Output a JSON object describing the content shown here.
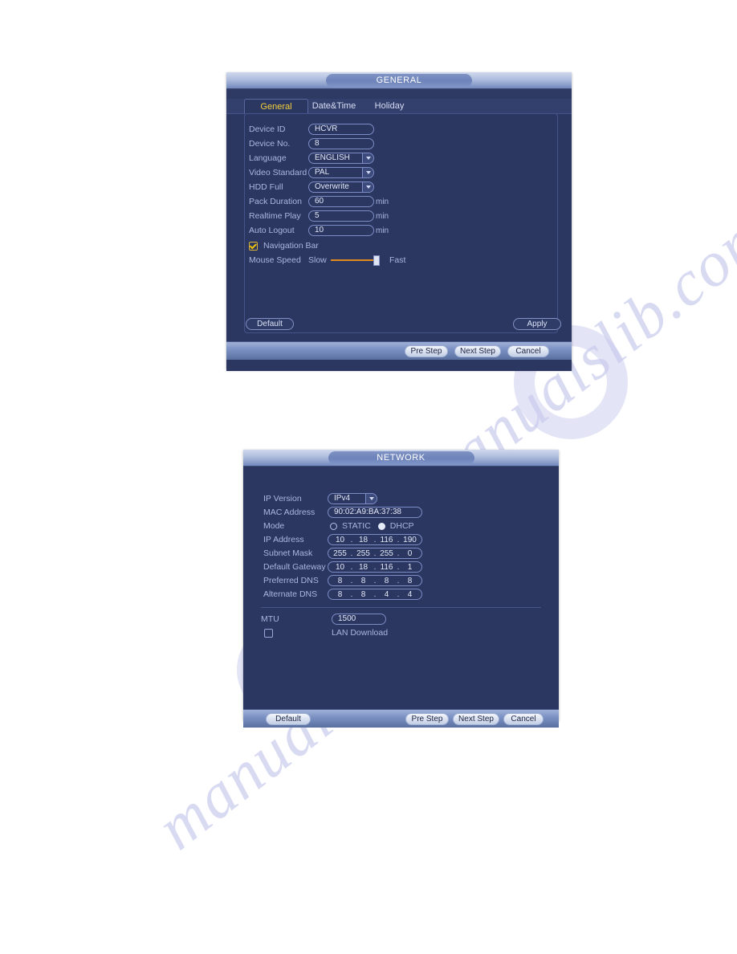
{
  "page": {
    "watermark_text": "manualslib.com"
  },
  "general_dialog": {
    "title": "GENERAL",
    "tabs": [
      {
        "label": "General",
        "active": true
      },
      {
        "label": "Date&Time",
        "active": false
      },
      {
        "label": "Holiday",
        "active": false
      }
    ],
    "fields": {
      "device_id": {
        "label": "Device ID",
        "value": "HCVR"
      },
      "device_no": {
        "label": "Device No.",
        "value": "8"
      },
      "language": {
        "label": "Language",
        "value": "ENGLISH"
      },
      "video_standard": {
        "label": "Video Standard",
        "value": "PAL"
      },
      "hdd_full": {
        "label": "HDD Full",
        "value": "Overwrite"
      },
      "pack_duration": {
        "label": "Pack Duration",
        "value": "60",
        "unit": "min"
      },
      "realtime_play": {
        "label": "Realtime Play",
        "value": "5",
        "unit": "min"
      },
      "auto_logout": {
        "label": "Auto Logout",
        "value": "10",
        "unit": "min"
      },
      "navigation_bar": {
        "label": "Navigation Bar",
        "checked": true
      },
      "mouse_speed": {
        "label": "Mouse Speed",
        "min_label": "Slow",
        "max_label": "Fast",
        "position_percent": 88
      }
    },
    "buttons": {
      "default": "Default",
      "apply": "Apply",
      "pre_step": "Pre Step",
      "next_step": "Next Step",
      "cancel": "Cancel"
    }
  },
  "network_dialog": {
    "title": "NETWORK",
    "fields": {
      "ip_version": {
        "label": "IP Version",
        "value": "IPv4"
      },
      "mac_address": {
        "label": "MAC Address",
        "value": "90:02:A9:BA:37:38"
      },
      "mode": {
        "label": "Mode",
        "static_label": "STATIC",
        "dhcp_label": "DHCP",
        "selected": "DHCP"
      },
      "ip_address": {
        "label": "IP Address",
        "octets": [
          "10",
          "18",
          "116",
          "190"
        ]
      },
      "subnet_mask": {
        "label": "Subnet Mask",
        "octets": [
          "255",
          "255",
          "255",
          "0"
        ]
      },
      "default_gateway": {
        "label": "Default Gateway",
        "octets": [
          "10",
          "18",
          "116",
          "1"
        ]
      },
      "preferred_dns": {
        "label": "Preferred DNS",
        "octets": [
          "8",
          "8",
          "8",
          "8"
        ]
      },
      "alternate_dns": {
        "label": "Alternate DNS",
        "octets": [
          "8",
          "8",
          "4",
          "4"
        ]
      },
      "mtu": {
        "label": "MTU",
        "value": "1500"
      },
      "lan_download": {
        "label": "LAN Download",
        "checked": false
      }
    },
    "buttons": {
      "default": "Default",
      "pre_step": "Pre Step",
      "next_step": "Next Step",
      "cancel": "Cancel"
    }
  }
}
